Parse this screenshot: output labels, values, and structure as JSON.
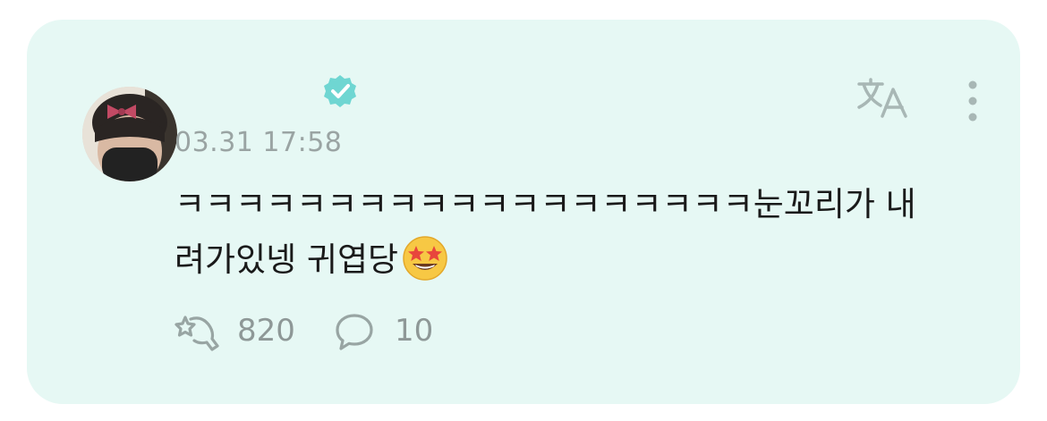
{
  "comment": {
    "timestamp": "03.31 17:58",
    "text_line1": "ㅋㅋㅋㅋㅋㅋㅋㅋㅋㅋㅋㅋㅋㅋㅋㅋㅋㅋㅋ눈꼬리가 내",
    "text_line2": "려가있넹 귀엽당",
    "emoji": "star-struck-emoji",
    "verified": true
  },
  "actions": {
    "likes_count": "820",
    "replies_count": "10"
  },
  "icons": {
    "verified": "verified-badge-icon",
    "translate": "translate-icon",
    "more": "more-vertical-icon",
    "like": "star-hand-icon",
    "reply": "speech-bubble-icon"
  },
  "colors": {
    "card_background": "#e6f8f4",
    "accent": "#6fd6d2",
    "muted": "#9aa4a3"
  }
}
